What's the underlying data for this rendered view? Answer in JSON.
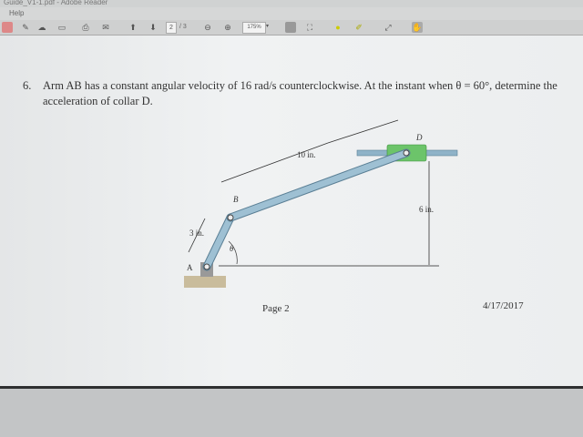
{
  "window": {
    "title": "Guide_V1-1.pdf - Adobe Reader"
  },
  "menu": {
    "items": [
      "Help"
    ]
  },
  "toolbar": {
    "page_current": "2",
    "page_total": "/ 3",
    "zoom": "175%",
    "zoom_dd": "▾"
  },
  "question": {
    "number": "6.",
    "text": "Arm AB has a constant angular velocity of 16 rad/s counterclockwise. At the instant when θ = 60°, determine the acceleration of collar D."
  },
  "diagram": {
    "labels": {
      "a": "A",
      "b": "B",
      "d": "D",
      "theta": "θ",
      "ab_len": "3 in.",
      "bd_len": "10 in.",
      "height": "6 in."
    },
    "colors": {
      "link": "#8fb3c8",
      "collar": "#6cc46a",
      "base": "#c9bc9c"
    }
  },
  "footer": {
    "page": "Page 2",
    "date": "4/17/2017"
  }
}
